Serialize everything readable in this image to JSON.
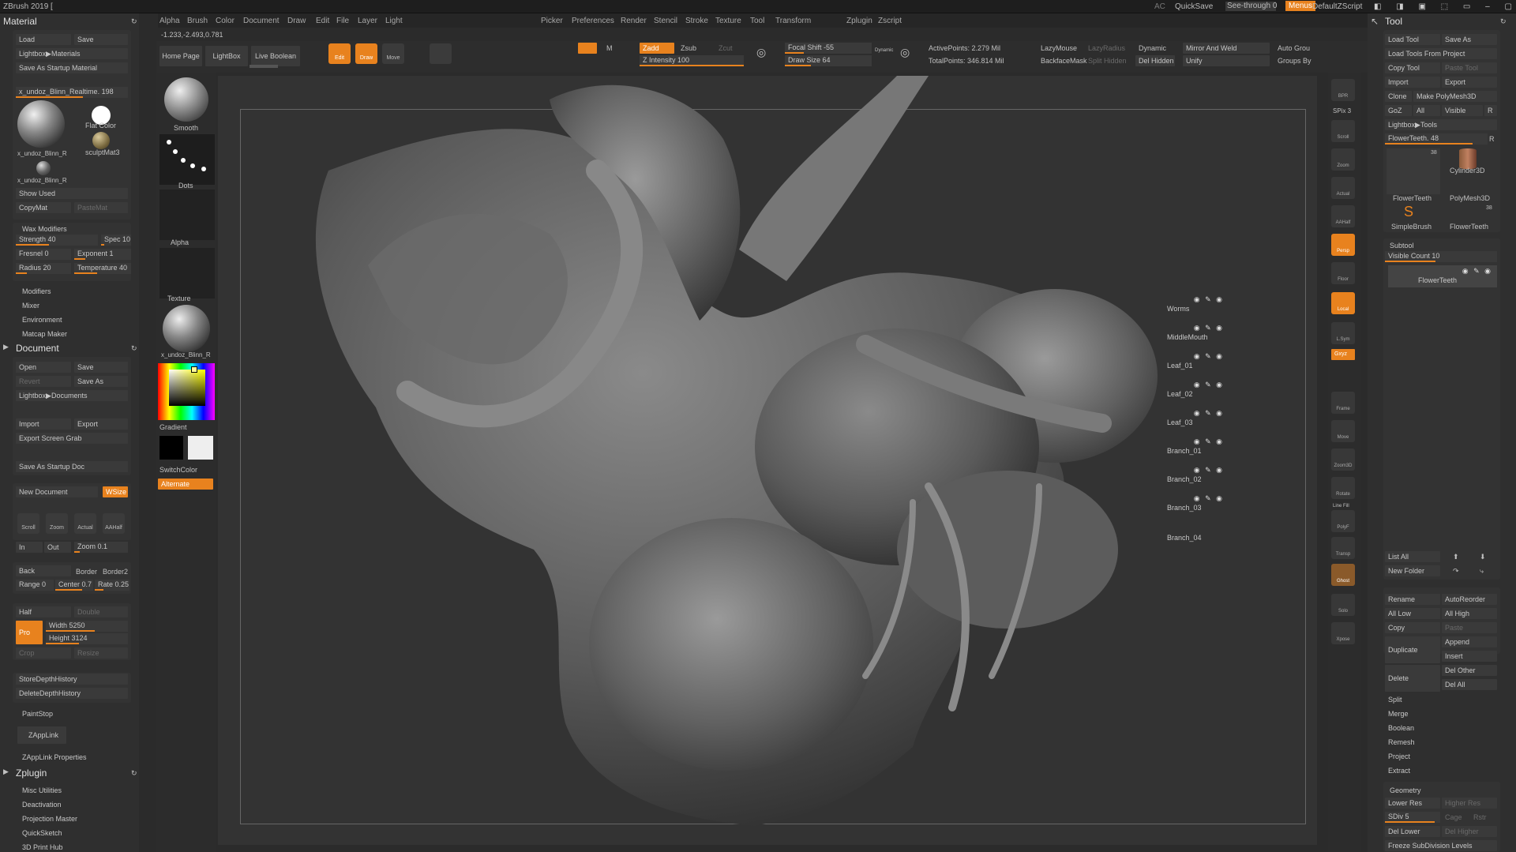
{
  "title_bar": {
    "app_title": "ZBrush 2019 [",
    "ac": "AC",
    "quicksave": "QuickSave",
    "see_through": "See-through 0",
    "menus": "Menus",
    "default_zscript": "DefaultZScript"
  },
  "menus": [
    "Alpha",
    "Brush",
    "Color",
    "Document",
    "Draw",
    "Edit",
    "File",
    "Layer",
    "Light",
    "Picker",
    "Preferences",
    "Render",
    "Stencil",
    "Stroke",
    "Texture",
    "Tool",
    "Transform",
    "Zplugin",
    "Zscript"
  ],
  "coords": "-1.233,-2.493,0.781",
  "top_shelf": {
    "home_page": "Home Page",
    "lightbox": "LightBox",
    "live_boolean": "Live Boolean",
    "edit": "Edit",
    "draw": "Draw",
    "move": "Move",
    "m_label": "M",
    "zadd": "Zadd",
    "zsub": "Zsub",
    "zcut": "Zcut",
    "z_intensity": "Z Intensity 100",
    "focal_shift": "Focal Shift -55",
    "draw_size": "Draw Size 64",
    "dynamic_small": "Dynamic",
    "active_points": "ActivePoints: 2.279 Mil",
    "total_points": "TotalPoints: 346.814 Mil",
    "lazymouse": "LazyMouse",
    "lazyradius": "LazyRadius",
    "backface_mask": "BackfaceMask",
    "split_hidden": "Split Hidden",
    "dynamic": "Dynamic",
    "del_hidden": "Del Hidden",
    "mirror_weld": "Mirror And Weld",
    "unify": "Unify",
    "auto_groups": "Auto Grou",
    "groups_by": "Groups By"
  },
  "material_panel": {
    "title": "Material",
    "load": "Load",
    "save": "Save",
    "lightbox_materials": "Lightbox▶Materials",
    "save_startup_material": "Save As Startup Material",
    "current_material": "x_undoz_Blinn_Realtime. 198",
    "flat_color": "Flat Color",
    "sculpt_mat": "sculptMat3",
    "mat_name": "x_undoz_Blinn_R",
    "mat_name2": "x_undoz_Blinn_R",
    "show_used": "Show Used",
    "copy_mat": "CopyMat",
    "paste_mat": "PasteMat",
    "wax_modifiers": "Wax Modifiers",
    "strength": "Strength 40",
    "spec": "Spec 10",
    "fresnel": "Fresnel 0",
    "exponent": "Exponent 1",
    "radius": "Radius 20",
    "temperature": "Temperature 40",
    "modifiers": "Modifiers",
    "mixer": "Mixer",
    "environment": "Environment",
    "matcap_maker": "Matcap Maker"
  },
  "document_panel": {
    "title": "Document",
    "open": "Open",
    "save": "Save",
    "revert": "Revert",
    "save_as": "Save As",
    "lightbox_documents": "Lightbox▶Documents",
    "import": "Import",
    "export": "Export",
    "export_screen_grab": "Export Screen Grab",
    "save_startup_doc": "Save As Startup Doc",
    "new_document": "New Document",
    "wsize": "WSize",
    "scroll": "Scroll",
    "zoom": "Zoom",
    "actual": "Actual",
    "aahalf": "AAHalf",
    "in": "In",
    "out": "Out",
    "zoom_val": "Zoom 0.1",
    "back": "Back",
    "border": "Border",
    "border2": "Border2",
    "range": "Range 0",
    "center": "Center 0.7",
    "rate": "Rate 0.25",
    "half": "Half",
    "double": "Double",
    "pro": "Pro",
    "width": "Width 5250",
    "height": "Height 3124",
    "crop": "Crop",
    "resize": "Resize",
    "store_depth": "StoreDepthHistory",
    "delete_depth": "DeleteDepthHistory",
    "paintstop": "PaintStop",
    "zapplink": "ZAppLink",
    "zapplink_props": "ZAppLink Properties"
  },
  "zplugin_panel": {
    "title": "Zplugin",
    "items": [
      "Misc Utilities",
      "Deactivation",
      "Projection Master",
      "QuickSketch",
      "3D Print Hub"
    ]
  },
  "left_shelf": {
    "smooth": "Smooth",
    "dots": "Dots",
    "alpha": "Alpha",
    "texture": "Texture",
    "material": "x_undoz_Blinn_R",
    "gradient": "Gradient",
    "switch_color": "SwitchColor",
    "alternate": "Alternate"
  },
  "right_shelf": [
    "BPR",
    "SPix 3",
    "Scroll",
    "Zoom",
    "Actual",
    "AAHalf",
    "Persp",
    "Floor",
    "Local",
    "L.Sym",
    "Gxyz",
    "Frame",
    "Move",
    "Zoom3D",
    "Rotate",
    "Line Fill",
    "PolyF",
    "Transp",
    "Ghost",
    "Solo",
    "Xpose"
  ],
  "tool_panel": {
    "title": "Tool",
    "load_tool": "Load Tool",
    "save_as": "Save As",
    "load_from_project": "Load Tools From Project",
    "copy_tool": "Copy Tool",
    "paste_tool": "Paste Tool",
    "import": "Import",
    "export": "Export",
    "clone": "Clone",
    "make_polymesh": "Make PolyMesh3D",
    "goz": "GoZ",
    "all": "All",
    "visible": "Visible",
    "r": "R",
    "lightbox_tools": "Lightbox▶Tools",
    "current_tool": "FlowerTeeth. 48",
    "thumb_flowerteeth": "FlowerTeeth",
    "thumb_cylinder": "Cylinder3D",
    "thumb_polymesh": "PolyMesh3D",
    "thumb_simplebrush": "SimpleBrush",
    "thumb_flowerteeth2": "FlowerTeeth",
    "count38": "38",
    "count38b": "38",
    "subtool": "Subtool",
    "visible_count": "Visible Count 10",
    "subtools": [
      "FlowerTeeth",
      "Worms",
      "MiddleMouth",
      "Leaf_01",
      "Leaf_02",
      "Leaf_03",
      "Branch_01",
      "Branch_02",
      "Branch_03",
      "Branch_04"
    ],
    "list_all": "List All",
    "new_folder": "New Folder",
    "rename": "Rename",
    "autoreorder": "AutoReorder",
    "all_low": "All Low",
    "all_high": "All High",
    "copy": "Copy",
    "paste": "Paste",
    "duplicate": "Duplicate",
    "append": "Append",
    "insert": "Insert",
    "delete": "Delete",
    "del_other": "Del Other",
    "del_all": "Del All",
    "split": "Split",
    "merge": "Merge",
    "boolean": "Boolean",
    "remesh": "Remesh",
    "project": "Project",
    "extract": "Extract",
    "geometry": "Geometry",
    "lower_res": "Lower Res",
    "higher_res": "Higher Res",
    "sdiv": "SDiv 5",
    "cage": "Cage",
    "rstr": "Rstr",
    "del_lower": "Del Lower",
    "del_higher": "Del Higher",
    "freeze_subdiv": "Freeze SubDivision Levels"
  }
}
